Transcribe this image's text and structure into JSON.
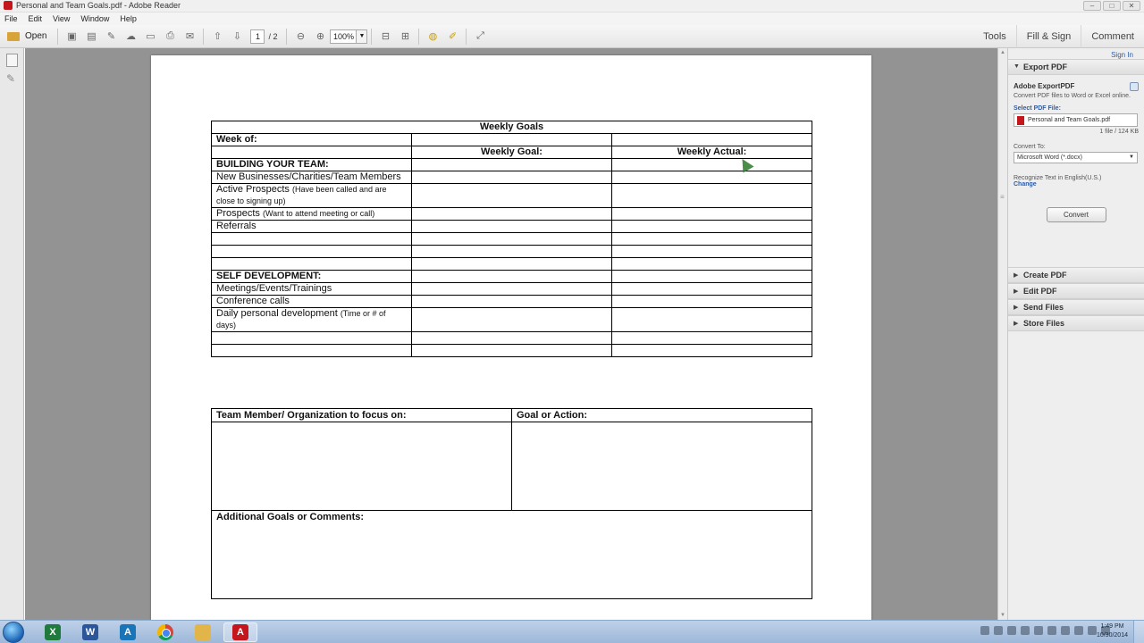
{
  "window": {
    "title": "Personal and Team Goals.pdf - Adobe Reader",
    "controls": [
      "–",
      "□",
      "✕"
    ]
  },
  "menu": [
    "File",
    "Edit",
    "View",
    "Window",
    "Help"
  ],
  "toolbar": {
    "open_label": "Open",
    "page_current": "1",
    "page_total": "/ 2",
    "zoom": "100%",
    "right_tabs": [
      "Tools",
      "Fill & Sign",
      "Comment"
    ]
  },
  "right_panel": {
    "sign_in": "Sign In",
    "export_header": "Export PDF",
    "export_title": "Adobe ExportPDF",
    "export_desc": "Convert PDF files to Word or Excel online.",
    "select_label": "Select PDF File:",
    "file_name": "Personal and Team Goals.pdf",
    "file_count": "1 file / 124 KB",
    "convert_to_label": "Convert To:",
    "convert_to_value": "Microsoft Word (*.docx)",
    "recognize_text": "Recognize Text in English(U.S.)",
    "change_link": "Change",
    "convert_button": "Convert",
    "sections": [
      "Create PDF",
      "Edit PDF",
      "Send Files",
      "Store Files"
    ]
  },
  "document": {
    "weekly_title": "Weekly Goals",
    "week_of": "Week of:",
    "col_goal": "Weekly Goal:",
    "col_actual": "Weekly Actual:",
    "building_team": "BUILDING YOUR TEAM:",
    "new_businesses": "New Businesses/Charities/Team Members",
    "active_prospects": "Active Prospects",
    "active_prospects_note": "(Have been called and are close to signing up)",
    "prospects": "Prospects",
    "prospects_note": "(Want to attend meeting or call)",
    "referrals": "Referrals",
    "self_dev": "SELF DEVELOPMENT:",
    "meetings": "Meetings/Events/Trainings",
    "conference": "Conference calls",
    "daily_dev": "Daily personal development",
    "daily_dev_note": "(Time or # of days)",
    "team_member_header": "Team Member/ Organization to focus on:",
    "goal_action_header": "Goal or Action:",
    "additional": "Additional Goals or Comments:"
  },
  "taskbar": {
    "time": "1:49 PM",
    "date": "10/30/2014"
  }
}
